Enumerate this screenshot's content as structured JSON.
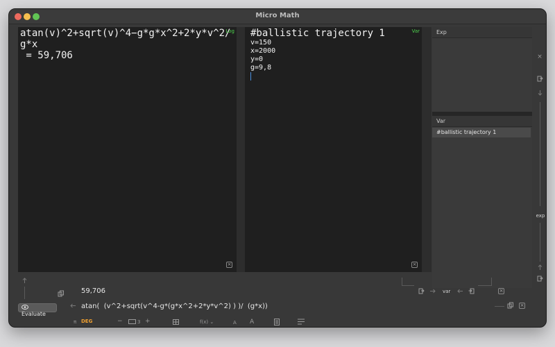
{
  "window": {
    "title": "Micro Math"
  },
  "log_pane": {
    "tag": "Log",
    "lines": [
      "atan(v)^2+sqrt(v)^4−g*g*x^2+2*y*v^2/",
      "g*x",
      " = 59,706"
    ],
    "close_glyph": "×"
  },
  "var_pane": {
    "tag": "Var",
    "heading": "#ballistic trajectory 1",
    "lines": [
      "v=150",
      "x=2000",
      "y=0",
      "g=9,8"
    ],
    "close_glyph": "×"
  },
  "side_panel": {
    "exp_header": "Exp",
    "var_header": "Var",
    "var_items": [
      "#ballistic trajectory 1"
    ]
  },
  "rail": {
    "label": "exp"
  },
  "bottom": {
    "result": "59,706",
    "expression": "atan(  (v^2+sqrt(v^4-g*(g*x^2+2*y*v^2) ) )/  (g*x))",
    "evaluate_label": "Evaluate",
    "pi_glyph": "π",
    "angle_mode": "DEG",
    "minus_glyph": "−",
    "precision": "3",
    "plus_glyph": "+",
    "fx_label": "f(x)",
    "font_small_label": "A",
    "font_large_label": "A",
    "var_label": "var",
    "close_glyph": "×"
  },
  "colors": {
    "accent_green": "#4ed24e",
    "angle_orange": "#f0a030",
    "caret_blue": "#4a90e2"
  },
  "icons": [
    "arrow-up-icon",
    "copy-icon",
    "arrow-left-icon",
    "eye-icon",
    "grid-icon",
    "chevron-down-icon",
    "document-icon",
    "list-icon",
    "export-icon",
    "arrow-right-icon",
    "import-icon",
    "arrow-down-icon"
  ]
}
